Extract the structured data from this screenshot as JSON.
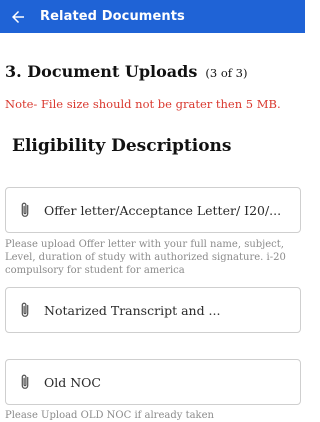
{
  "appbar": {
    "title": "Related Documents",
    "back_icon": "arrow-left-icon"
  },
  "section": {
    "heading": "3. Document Uploads",
    "counter": "(3 of 3)"
  },
  "note": "Note- File size should not be grater then 5 MB.",
  "eligibility_heading": "Eligibility Descriptions",
  "uploads": [
    {
      "label": "Offer letter/Acceptance Letter/ I20/...",
      "help": "Please upload Offer letter with your full name, subject, Level, duration of study with authorized signature.  i-20 compulsory for student for america"
    },
    {
      "label": "Notarized Transcript and ...",
      "help": ""
    },
    {
      "label": "Old NOC",
      "help": "Please Upload OLD NOC if already taken"
    }
  ],
  "colors": {
    "appbar": "#1f63d6",
    "note": "#d9382e",
    "help": "#8b8b8b"
  }
}
